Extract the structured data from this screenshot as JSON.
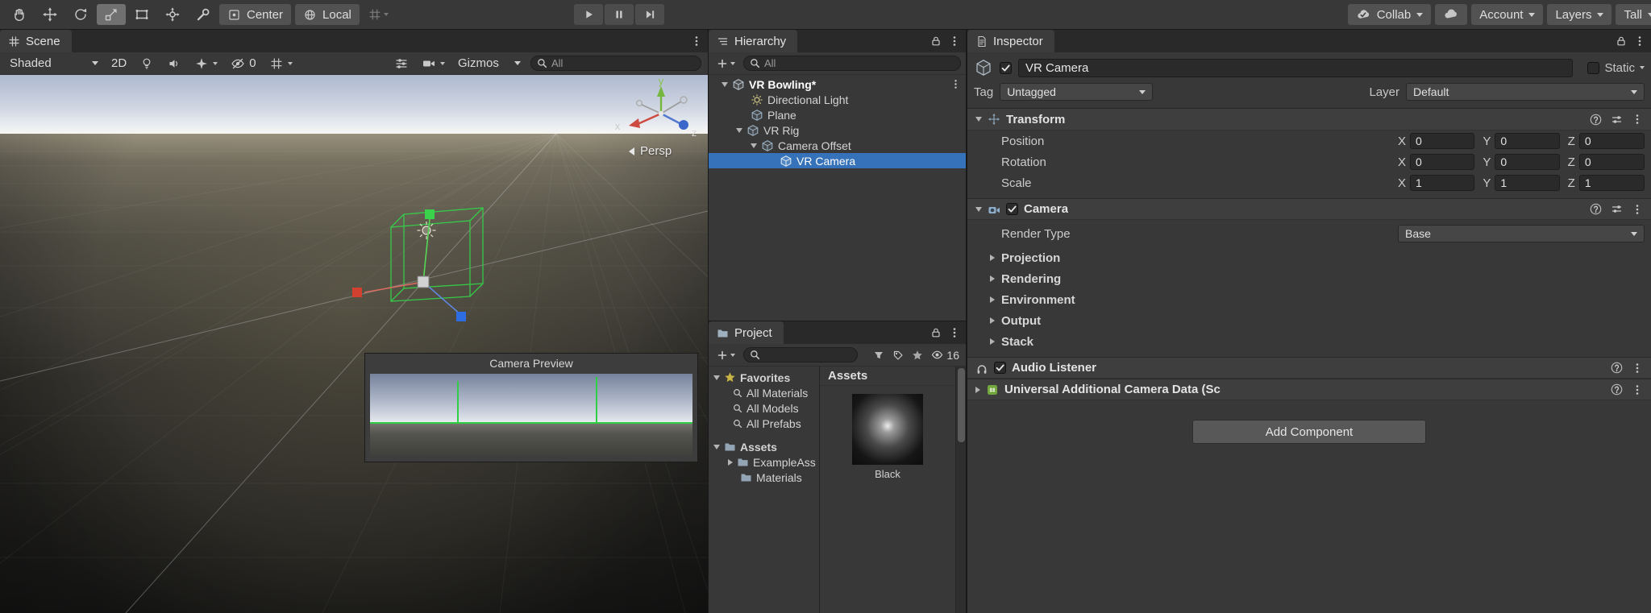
{
  "toolbar": {
    "center_label": "Center",
    "local_label": "Local",
    "collab_label": "Collab",
    "account_label": "Account",
    "layers_label": "Layers",
    "layout_label": "Tall"
  },
  "scene": {
    "tab_label": "Scene",
    "shading_mode": "Shaded",
    "mode_2d": "2D",
    "hidden_count": "0",
    "gizmos_label": "Gizmos",
    "search_value": "All",
    "persp_label": "Persp",
    "axis": {
      "x": "x",
      "y": "y",
      "z": "z"
    },
    "camera_preview_title": "Camera Preview"
  },
  "hierarchy": {
    "tab_label": "Hierarchy",
    "search_value": "All",
    "items": [
      {
        "label": "VR Bowling*"
      },
      {
        "label": "Directional Light"
      },
      {
        "label": "Plane"
      },
      {
        "label": "VR Rig"
      },
      {
        "label": "Camera Offset"
      },
      {
        "label": "VR Camera"
      }
    ]
  },
  "project": {
    "tab_label": "Project",
    "hidden_count": "16",
    "favorites_label": "Favorites",
    "favorites": [
      {
        "label": "All Materials"
      },
      {
        "label": "All Models"
      },
      {
        "label": "All Prefabs"
      }
    ],
    "assets_folder_label": "Assets",
    "folders": [
      {
        "label": "ExampleAss"
      },
      {
        "label": "Materials"
      }
    ],
    "breadcrumb": "Assets",
    "asset_label": "Black"
  },
  "inspector": {
    "tab_label": "Inspector",
    "object_name": "VR Camera",
    "static_label": "Static",
    "tag_label": "Tag",
    "tag_value": "Untagged",
    "layer_label": "Layer",
    "layer_value": "Default",
    "axis": {
      "x": "X",
      "y": "Y",
      "z": "Z"
    },
    "transform": {
      "title": "Transform",
      "rows": [
        {
          "label": "Position",
          "x": "0",
          "y": "0",
          "z": "0"
        },
        {
          "label": "Rotation",
          "x": "0",
          "y": "0",
          "z": "0"
        },
        {
          "label": "Scale",
          "x": "1",
          "y": "1",
          "z": "1"
        }
      ]
    },
    "camera": {
      "title": "Camera",
      "render_type_label": "Render Type",
      "render_type_value": "Base",
      "foldouts": [
        {
          "label": "Projection"
        },
        {
          "label": "Rendering"
        },
        {
          "label": "Environment"
        },
        {
          "label": "Output"
        },
        {
          "label": "Stack"
        }
      ]
    },
    "audio_listener_title": "Audio Listener",
    "uacd_title": "Universal Additional Camera Data (Sc",
    "add_component_label": "Add Component"
  }
}
